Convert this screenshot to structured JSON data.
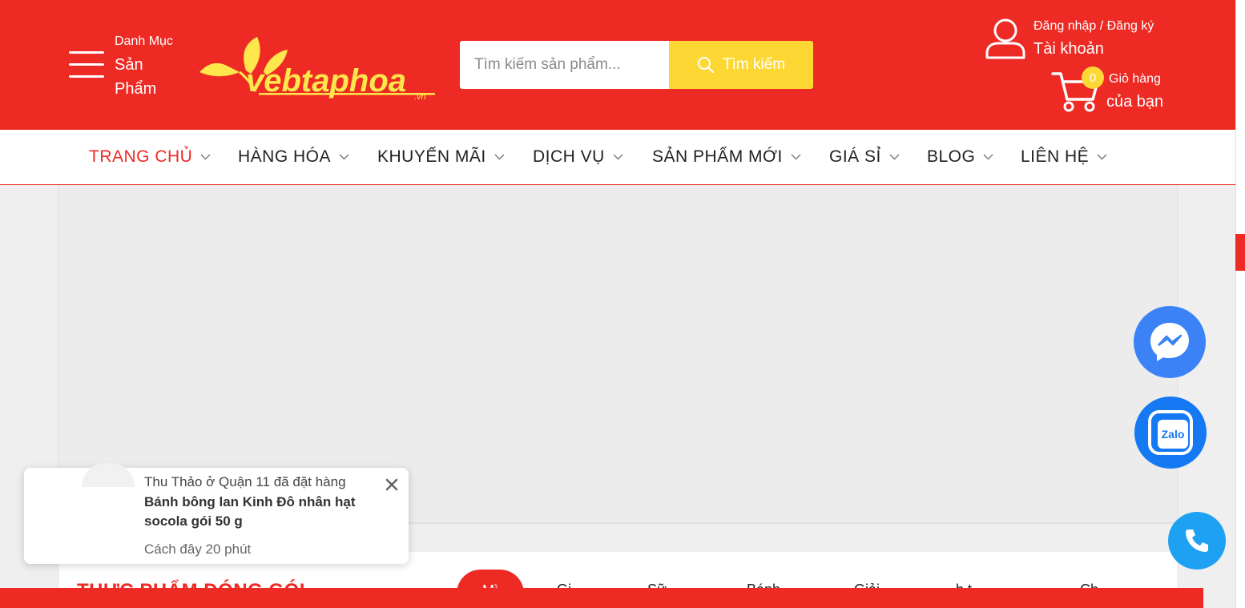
{
  "header": {
    "category_small": "Danh Mục",
    "category_big": "Sản Phẩm",
    "logo_text": "vebtaphoa",
    "logo_sub": ".vn",
    "search": {
      "placeholder": "Tìm kiếm sản phẩm...",
      "button_label": "Tìm kiếm"
    },
    "account": {
      "login_text": "Đăng nhập / Đăng ký",
      "label": "Tài khoản"
    },
    "cart": {
      "count": "0",
      "label_line1": "Giỏ hàng",
      "label_line2": "của bạn"
    }
  },
  "nav": {
    "items": [
      {
        "label": "TRANG CHỦ"
      },
      {
        "label": "HÀNG HÓA"
      },
      {
        "label": "KHUYẾN MÃI"
      },
      {
        "label": "DỊCH VỤ"
      },
      {
        "label": "SẢN PHẨM MỚI"
      },
      {
        "label": "GIÁ SỈ"
      },
      {
        "label": "BLOG"
      },
      {
        "label": "LIÊN HỆ"
      }
    ]
  },
  "section": {
    "title": "THỰC PHẨM ĐÓNG GÓI",
    "tabs": [
      "Mì",
      "Gi",
      "Sữ",
      "Bánh",
      "Giải",
      "b t",
      "Ch"
    ]
  },
  "toast": {
    "line1": "Thu Thảo ở Quận 11 đã đặt hàng",
    "product": "Bánh bông lan Kinh Đô nhân hạt socola gói 50 g",
    "time": "Cách đây 20 phút"
  },
  "floating": {
    "zalo_label": "Zalo"
  },
  "colors": {
    "brand_red": "#ee2a24",
    "search_yellow": "#fdd835",
    "messenger_blue": "#3b82f6",
    "zalo_blue": "#1479f2",
    "phone_blue": "#1ea1f2"
  }
}
